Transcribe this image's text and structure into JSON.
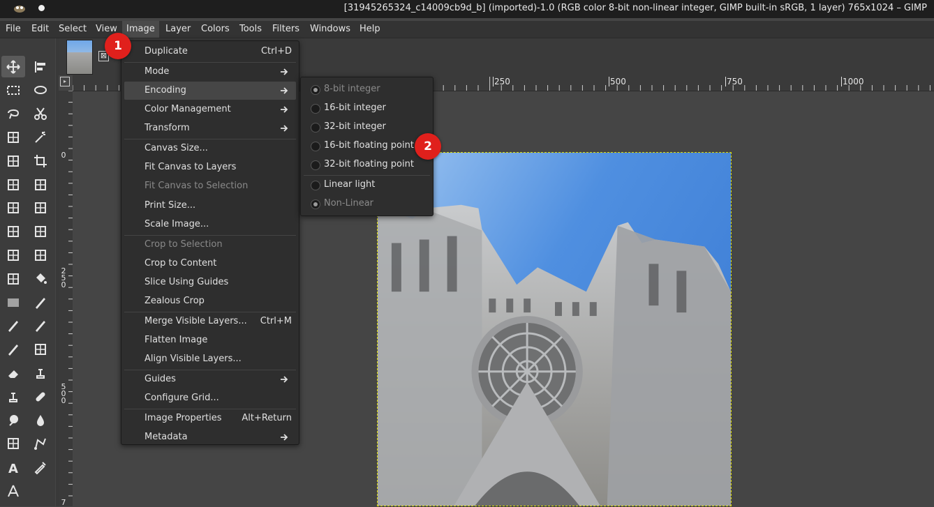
{
  "window": {
    "title": "[31945265324_c14009cb9d_b] (imported)-1.0 (RGB color 8-bit non-linear integer, GIMP built-in sRGB, 1 layer) 765x1024 – GIMP"
  },
  "menubar": [
    "File",
    "Edit",
    "Select",
    "View",
    "Image",
    "Layer",
    "Colors",
    "Tools",
    "Filters",
    "Windows",
    "Help"
  ],
  "image_tab": {
    "close_glyph": "⊠"
  },
  "rulers": {
    "top": [
      "250",
      "500",
      "750",
      "1000"
    ],
    "left": [
      "0",
      "2\n5\n0",
      "5\n0\n0",
      "7"
    ]
  },
  "image_menu": [
    {
      "label": "Duplicate",
      "shortcut": "Ctrl+D"
    },
    {
      "label": "Mode",
      "submenu": true
    },
    {
      "label": "Encoding",
      "submenu": true,
      "highlighted": true
    },
    {
      "label": "Color Management",
      "submenu": true
    },
    {
      "label": "Transform",
      "submenu": true
    },
    {
      "label": "Canvas Size..."
    },
    {
      "label": "Fit Canvas to Layers"
    },
    {
      "label": "Fit Canvas to Selection",
      "disabled": true
    },
    {
      "label": "Print Size..."
    },
    {
      "label": "Scale Image..."
    },
    {
      "label": "Crop to Selection",
      "disabled": true
    },
    {
      "label": "Crop to Content"
    },
    {
      "label": "Slice Using Guides"
    },
    {
      "label": "Zealous Crop"
    },
    {
      "label": "Merge Visible Layers...",
      "shortcut": "Ctrl+M"
    },
    {
      "label": "Flatten Image"
    },
    {
      "label": "Align Visible Layers..."
    },
    {
      "label": "Guides",
      "submenu": true
    },
    {
      "label": "Configure Grid..."
    },
    {
      "label": "Image Properties",
      "shortcut": "Alt+Return"
    },
    {
      "label": "Metadata",
      "submenu": true
    }
  ],
  "encoding_submenu": [
    {
      "label": "8-bit integer",
      "checked": true,
      "disabled": true
    },
    {
      "label": "16-bit integer"
    },
    {
      "label": "32-bit integer"
    },
    {
      "label": "16-bit floating point"
    },
    {
      "label": "32-bit floating point"
    },
    {
      "label": "Linear light"
    },
    {
      "label": "Non-Linear",
      "checked": true,
      "disabled": true
    }
  ],
  "badges": [
    "1",
    "2"
  ],
  "colors": {
    "badge": "#e0201c",
    "menu_bg": "#2e2e2e",
    "highlight": "#464646",
    "selection_outline": "#d8d800"
  },
  "icons": {
    "toolbox": [
      "move-icon",
      "align-icon",
      "rect-select-icon",
      "ellipse-select-icon",
      "free-select-icon",
      "scissors-select-icon",
      "foreground-select-icon",
      "fuzzy-select-icon",
      "by-color-select-icon",
      "crop-icon",
      "unified-transform-icon",
      "rotate-icon",
      "scale-icon",
      "shear-icon",
      "flip-icon",
      "perspective-icon",
      "cage-transform-icon",
      "warp-transform-icon",
      "handle-transform-icon",
      "bucket-fill-icon",
      "gradient-icon",
      "paintbrush-icon",
      "pencil-icon",
      "ink-icon",
      "airbrush-icon",
      "mypaint-brush-icon",
      "eraser-icon",
      "clone-icon",
      "perspective-clone-icon",
      "heal-icon",
      "smudge-icon",
      "blur-icon",
      "dodge-burn-icon",
      "paths-icon",
      "text-icon",
      "color-picker-icon",
      "measure-icon"
    ]
  }
}
